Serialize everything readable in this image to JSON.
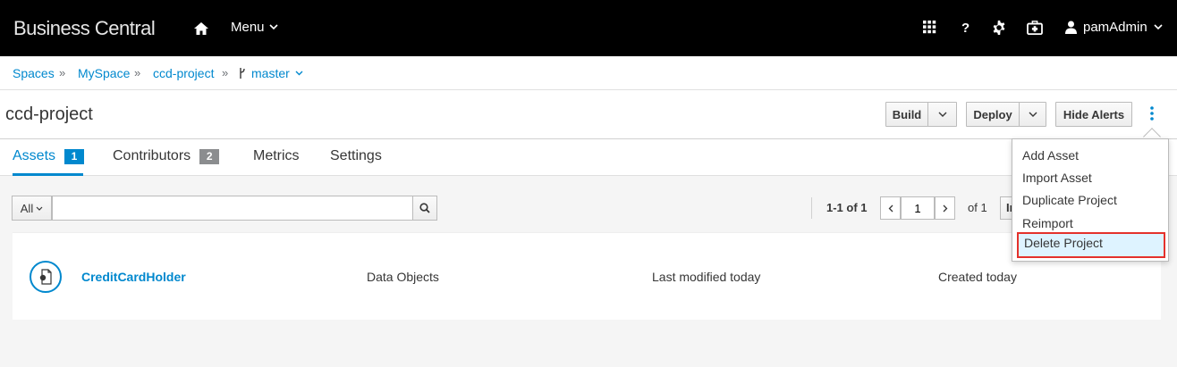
{
  "app": {
    "brand": "Business Central"
  },
  "topbar": {
    "menu_label": "Menu",
    "user_label": "pamAdmin",
    "help_label": "?"
  },
  "breadcrumb": {
    "items": [
      "Spaces",
      "MySpace",
      "ccd-project",
      "master"
    ],
    "separator": "»"
  },
  "titlebar": {
    "title": "ccd-project",
    "build_label": "Build",
    "deploy_label": "Deploy",
    "hide_alerts_label": "Hide Alerts"
  },
  "tabs": [
    {
      "label": "Assets",
      "badge": "1"
    },
    {
      "label": "Contributors",
      "badge": "2"
    },
    {
      "label": "Metrics"
    },
    {
      "label": "Settings"
    }
  ],
  "toolbar": {
    "filter_value": "All",
    "search_value": "",
    "pagination_text": "1-1 of 1",
    "page_value": "1",
    "of_text": "of 1",
    "partial_button": "In"
  },
  "asset": {
    "name": "CreditCardHolder",
    "type": "Data Objects",
    "modified": "Last modified today",
    "created": "Created today"
  },
  "dropdown": {
    "items": [
      "Add Asset",
      "Import Asset",
      "Duplicate Project",
      "Reimport",
      "Delete Project"
    ]
  },
  "colors": {
    "accent": "#0088ce",
    "highlight_border": "#e4312b"
  }
}
